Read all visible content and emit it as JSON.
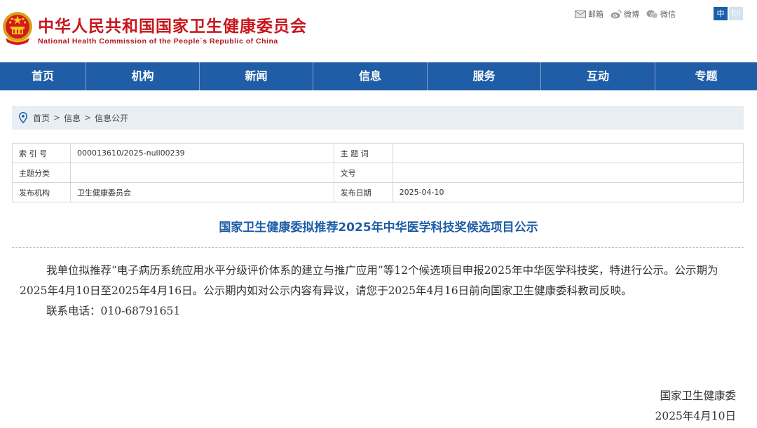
{
  "header": {
    "title": "中华人民共和国国家卫生健康委员会",
    "subtitle": "National Health Commission of the People´s Republic of China",
    "emblem_icon": "national-emblem-icon",
    "links": [
      {
        "label": "邮箱",
        "icon": "mail-icon"
      },
      {
        "label": "微博",
        "icon": "weibo-icon"
      },
      {
        "label": "微信",
        "icon": "wechat-icon"
      }
    ],
    "lang_zh": "中",
    "lang_en": "En"
  },
  "nav": {
    "items": [
      "首页",
      "机构",
      "新闻",
      "信息",
      "服务",
      "互动",
      "专题"
    ]
  },
  "breadcrumb": {
    "icon": "location-pin-icon",
    "items": [
      "首页",
      "信息",
      "信息公开"
    ],
    "separator": ">"
  },
  "info": {
    "index_label": "索 引 号",
    "index_value": "000013610/2025-null00239",
    "subject_words_label": "主 题 词",
    "subject_words_value": "",
    "category_label": "主题分类",
    "category_value": "",
    "doc_no_label": "文号",
    "doc_no_value": "",
    "publisher_label": "发布机构",
    "publisher_value": "卫生健康委员会",
    "date_label": "发布日期",
    "date_value": "2025-04-10"
  },
  "article": {
    "title": "国家卫生健康委拟推荐2025年中华医学科技奖候选项目公示",
    "paragraph1": "我单位拟推荐“电子病历系统应用水平分级评价体系的建立与推广应用”等12个候选项目申报2025年中华医学科技奖，特进行公示。公示期为2025年4月10日至2025年4月16日。公示期内如对公示内容有异议，请您于2025年4月16日前向国家卫生健康委科教司反映。",
    "paragraph2": "联系电话：010-68791651",
    "signature_org": "国家卫生健康委",
    "signature_date": "2025年4月10日"
  },
  "colors": {
    "brand_red": "#c8161d",
    "nav_blue": "#1f5da7",
    "title_blue": "#1f5da7",
    "breadcrumb_bg": "#e9eef5"
  }
}
